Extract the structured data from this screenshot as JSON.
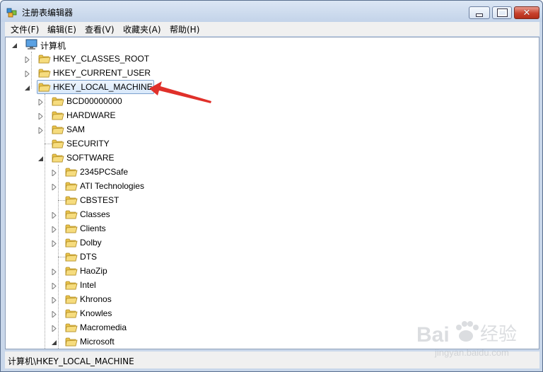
{
  "window": {
    "title": "注册表编辑器",
    "controls": [
      "minimize",
      "maximize",
      "close"
    ]
  },
  "menu": {
    "items": [
      "文件(F)",
      "编辑(E)",
      "查看(V)",
      "收藏夹(A)",
      "帮助(H)"
    ]
  },
  "tree": {
    "root": "计算机",
    "hives": [
      "HKEY_CLASSES_ROOT",
      "HKEY_CURRENT_USER",
      "HKEY_LOCAL_MACHINE"
    ],
    "hklm_children": [
      "BCD00000000",
      "HARDWARE",
      "SAM",
      "SECURITY",
      "SOFTWARE"
    ],
    "software_children": [
      "2345PCSafe",
      "ATI Technologies",
      "CBSTEST",
      "Classes",
      "Clients",
      "Dolby",
      "DTS",
      "HaoZip",
      "Intel",
      "Khronos",
      "Knowles",
      "Macromedia",
      "Microsoft"
    ],
    "selected": "HKEY_LOCAL_MACHINE"
  },
  "status": {
    "path": "计算机\\HKEY_LOCAL_MACHINE"
  },
  "watermark": {
    "brand": "Bai",
    "brand_cn": "经验",
    "url": "jingyan.baidu.com"
  },
  "colors": {
    "folder": "#e8c24a",
    "arrow": "#e0302a",
    "selection": "#d8e8fa"
  }
}
